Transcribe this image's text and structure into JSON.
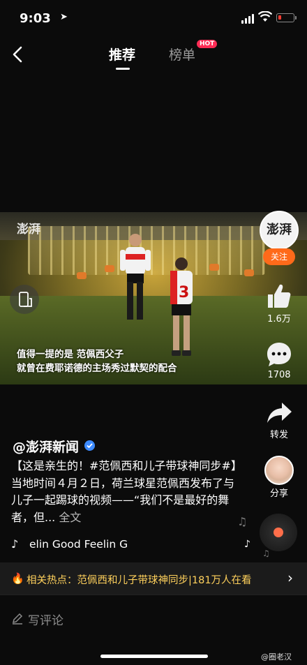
{
  "status": {
    "time": "9:03",
    "battery_color": "#ff3b30"
  },
  "nav": {
    "back_icon": "chevron-left-icon",
    "tabs": [
      {
        "label": "推荐"
      },
      {
        "label": "榜单"
      }
    ],
    "hot_badge": "HOT"
  },
  "video": {
    "watermark": "澎湃",
    "subtitle_lines": [
      "值得一提的是 范佩西父子",
      "就曾在费耶诺德的主场秀过默契的配合"
    ],
    "jersey_number": "3"
  },
  "rail": {
    "avatar_text": "澎湃",
    "follow_label": "关注",
    "likes": "1.6万",
    "comments": "1708",
    "forward_label": "转发",
    "share_label": "分享"
  },
  "post": {
    "author": "@澎湃新闻",
    "caption": "【这是亲生的！#范佩西和儿子带球神同步#】当地时间４月２日，荷兰球星范佩西发布了与儿子一起踢球的视频——“我们不是最好的舞者，但...",
    "more_label": "全文",
    "music": "elin Good   Feelin G"
  },
  "hot_topic": {
    "label": "相关热点：范佩西和儿子带球神同步|181万人在看"
  },
  "comment": {
    "placeholder": "写评论"
  },
  "watermark_credit": "@圈老汉",
  "colors": {
    "accent": "#ff6a1a",
    "hot": "#fe2c55",
    "hot_text": "#ffd15c"
  }
}
